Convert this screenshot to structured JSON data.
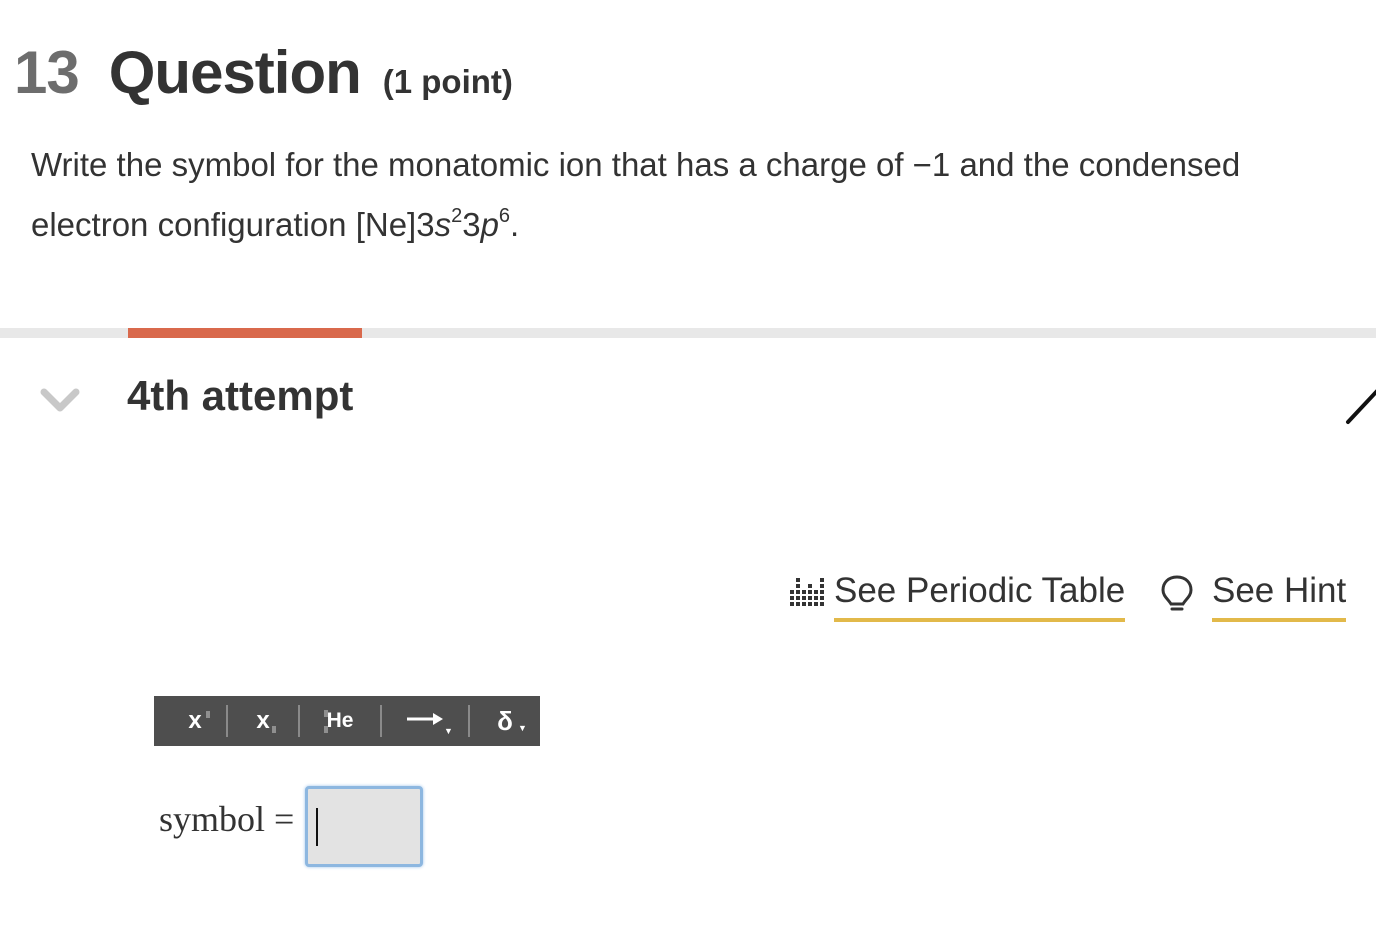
{
  "question": {
    "number": "13",
    "title": "Question",
    "points": "(1 point)",
    "text_line1": "Write the symbol for the monatomic ion that has a charge of −1 and the condensed",
    "text_line2_prefix": "electron configuration [Ne]3",
    "text_s": "s",
    "text_s_exp": "2",
    "text_mid": "3",
    "text_p": "p",
    "text_p_exp": "6",
    "text_end": "."
  },
  "progress": {
    "fraction": 0.17,
    "color": "#d9694c"
  },
  "attempt": {
    "label": "4th attempt",
    "icon": "chevron-down-icon"
  },
  "links": {
    "periodic_table": "See Periodic Table",
    "periodic_icon": "periodic-table-icon",
    "hint": "See Hint",
    "hint_icon": "lightbulb-icon",
    "underline_color": "#e2b94a"
  },
  "toolbar": {
    "superscript": "x",
    "subscript": "x",
    "element": "He",
    "arrow_icon": "reaction-arrow-icon",
    "delta": "δ"
  },
  "answer": {
    "label": "symbol =",
    "value": ""
  }
}
